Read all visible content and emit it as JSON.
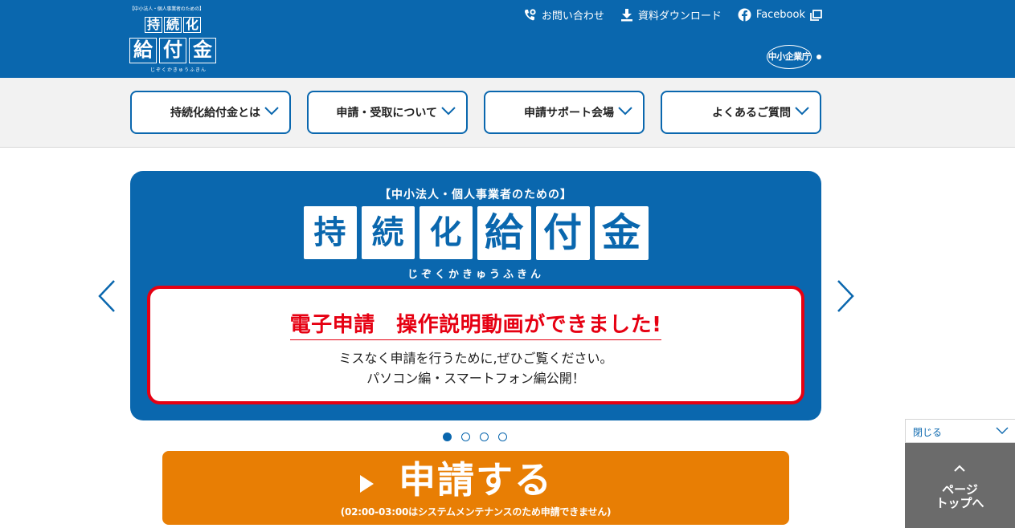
{
  "header": {
    "logo": {
      "subtitle": "【中小法人・個人事業者のための】",
      "row1": [
        "持",
        "続",
        "化"
      ],
      "row2": [
        "給",
        "付",
        "金"
      ],
      "ruby": "じぞくかきゅうふきん"
    },
    "links": [
      {
        "label": "お問い合わせ",
        "icon": "phone-icon"
      },
      {
        "label": "資料ダウンロード",
        "icon": "download-icon"
      },
      {
        "label": "Facebook",
        "icon": "facebook-icon"
      }
    ],
    "agency": "中小企業庁"
  },
  "nav": {
    "items": [
      {
        "label": "持続化給付金とは"
      },
      {
        "label": "申請・受取について"
      },
      {
        "label": "申請サポート会場"
      },
      {
        "label": "よくあるご質問"
      }
    ]
  },
  "slide": {
    "subtitle": "【中小法人・個人事業者のための】",
    "title_chars": [
      "持",
      "続",
      "化",
      "給",
      "付",
      "金"
    ],
    "ruby": "じぞくかきゅうふきん",
    "notice_heading": "電子申請　操作説明動画ができました!",
    "notice_line1": "ミスなく申請を行うために,ぜひご覧ください。",
    "notice_line2": "パソコン編・スマートフォン編公開！"
  },
  "carousel": {
    "dot_count": 4,
    "active_index": 0
  },
  "apply": {
    "label": "申請する",
    "note": "(02:00-03:00はシステムメンテナンスのため申請できません)"
  },
  "side": {
    "close_label": "閉じる",
    "page_top_line1": "ページ",
    "page_top_line2": "トップへ"
  },
  "colors": {
    "primary": "#0a67ae",
    "accent": "#e87e04",
    "alert": "#e60012",
    "nav_bg": "#f2f2f2",
    "side_gray": "#6b6b6b"
  }
}
